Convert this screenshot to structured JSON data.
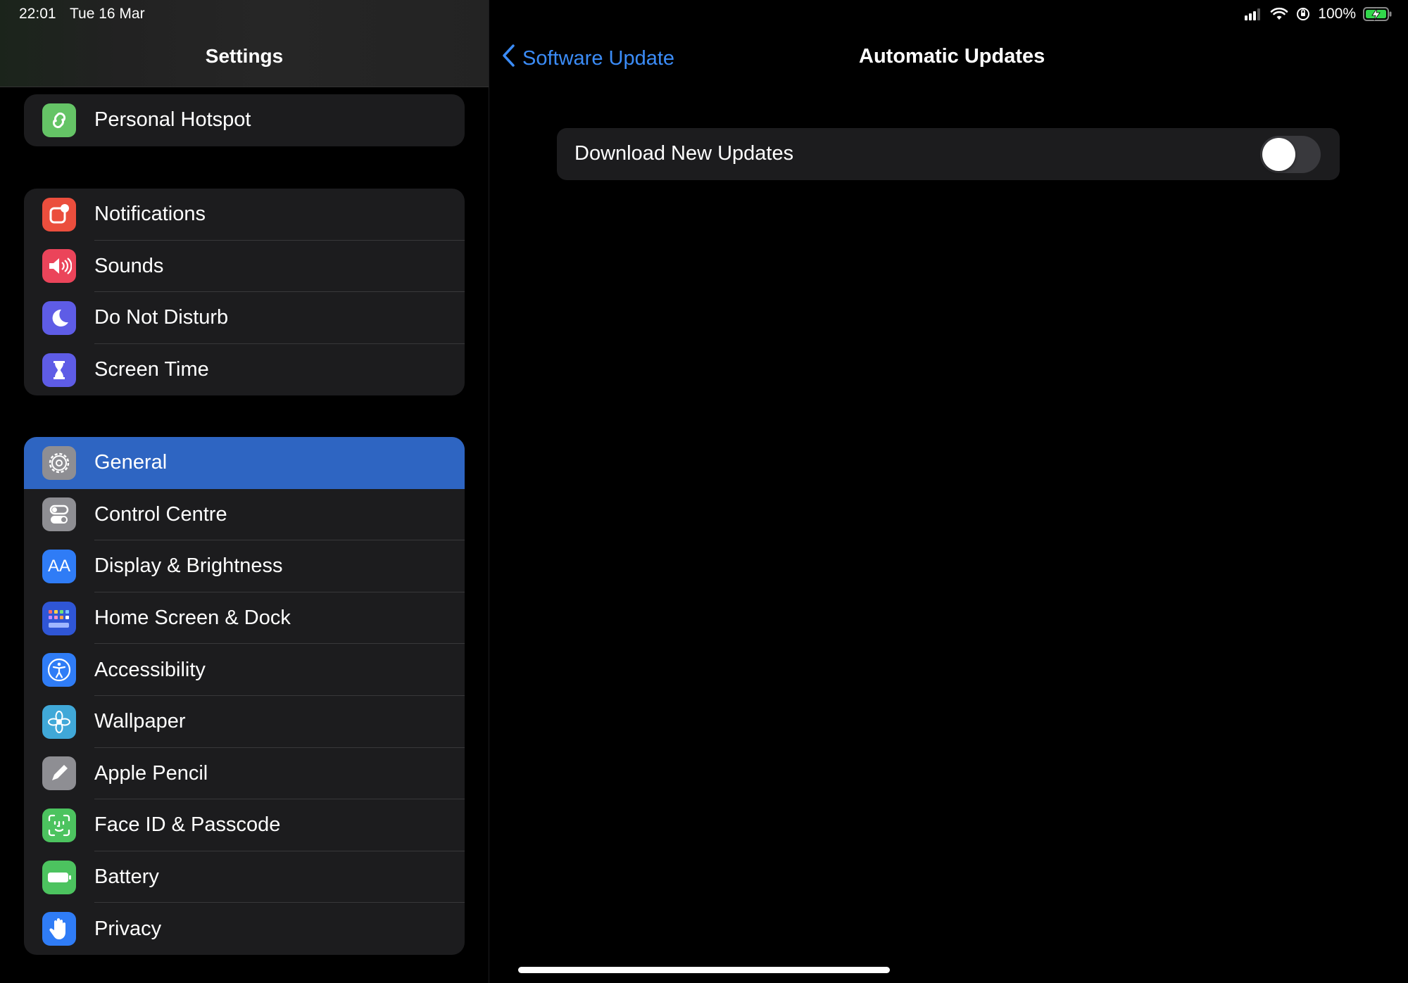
{
  "status_bar": {
    "time": "22:01",
    "date": "Tue 16 Mar",
    "battery_percent": "100%",
    "icons": [
      "cellular-signal-icon",
      "wifi-icon",
      "orientation-lock-icon",
      "battery-charging-icon"
    ]
  },
  "sidebar": {
    "title": "Settings",
    "groups": [
      {
        "items": [
          {
            "label": "Personal Hotspot",
            "icon": "personal-hotspot-icon",
            "color": "#65c466"
          }
        ]
      },
      {
        "items": [
          {
            "label": "Notifications",
            "icon": "notifications-icon",
            "color": "#eb4e3d"
          },
          {
            "label": "Sounds",
            "icon": "sounds-icon",
            "color": "#eb445a"
          },
          {
            "label": "Do Not Disturb",
            "icon": "moon-icon",
            "color": "#5e5ce6"
          },
          {
            "label": "Screen Time",
            "icon": "hourglass-icon",
            "color": "#5e5ce6"
          }
        ]
      },
      {
        "items": [
          {
            "label": "General",
            "icon": "gear-icon",
            "color": "#8e8e93",
            "selected": true
          },
          {
            "label": "Control Centre",
            "icon": "control-centre-icon",
            "color": "#8e8e93"
          },
          {
            "label": "Display & Brightness",
            "icon": "display-brightness-icon",
            "color": "#2f7cf6",
            "glyph": "AA"
          },
          {
            "label": "Home Screen & Dock",
            "icon": "home-screen-icon",
            "color": "#2f56d6"
          },
          {
            "label": "Accessibility",
            "icon": "accessibility-icon",
            "color": "#2f7cf6"
          },
          {
            "label": "Wallpaper",
            "icon": "wallpaper-flower-icon",
            "color": "#40a8d8"
          },
          {
            "label": "Apple Pencil",
            "icon": "pencil-icon",
            "color": "#8e8e93"
          },
          {
            "label": "Face ID & Passcode",
            "icon": "face-id-icon",
            "color": "#4cc35f"
          },
          {
            "label": "Battery",
            "icon": "battery-icon",
            "color": "#4cc35f"
          },
          {
            "label": "Privacy",
            "icon": "hand-icon",
            "color": "#2f7cf6"
          }
        ]
      }
    ]
  },
  "detail": {
    "back_label": "Software Update",
    "title": "Automatic Updates",
    "settings": [
      {
        "label": "Download New Updates",
        "enabled": false
      }
    ]
  },
  "colors": {
    "accent": "#3b8cf7",
    "selected_row": "#2e65c2",
    "cell_background": "#1c1c1e"
  }
}
